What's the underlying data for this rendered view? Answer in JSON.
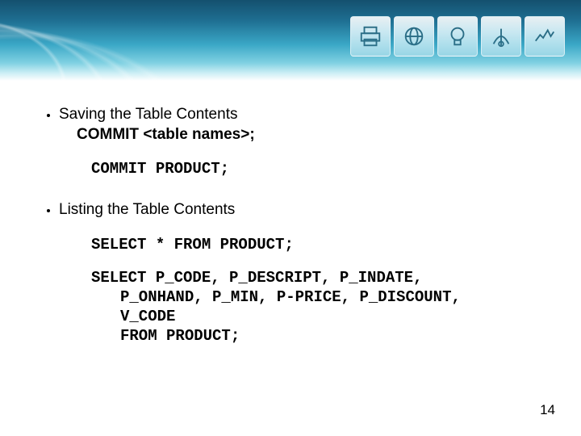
{
  "header": {
    "icons": [
      "printer",
      "globe",
      "bulb",
      "satellite",
      "chart"
    ]
  },
  "content": {
    "item1": {
      "title": "Saving the Table Contents",
      "syntax": "COMMIT <table names>;",
      "example": "COMMIT PRODUCT;"
    },
    "item2": {
      "title": "Listing the Table Contents",
      "example1": "SELECT * FROM PRODUCT;",
      "example2": {
        "l1": "SELECT P_CODE, P_DESCRIPT, P_INDATE,",
        "l2": "P_ONHAND, P_MIN, P-PRICE, P_DISCOUNT,",
        "l3": "V_CODE",
        "l4": "FROM PRODUCT;"
      }
    }
  },
  "page": "14"
}
